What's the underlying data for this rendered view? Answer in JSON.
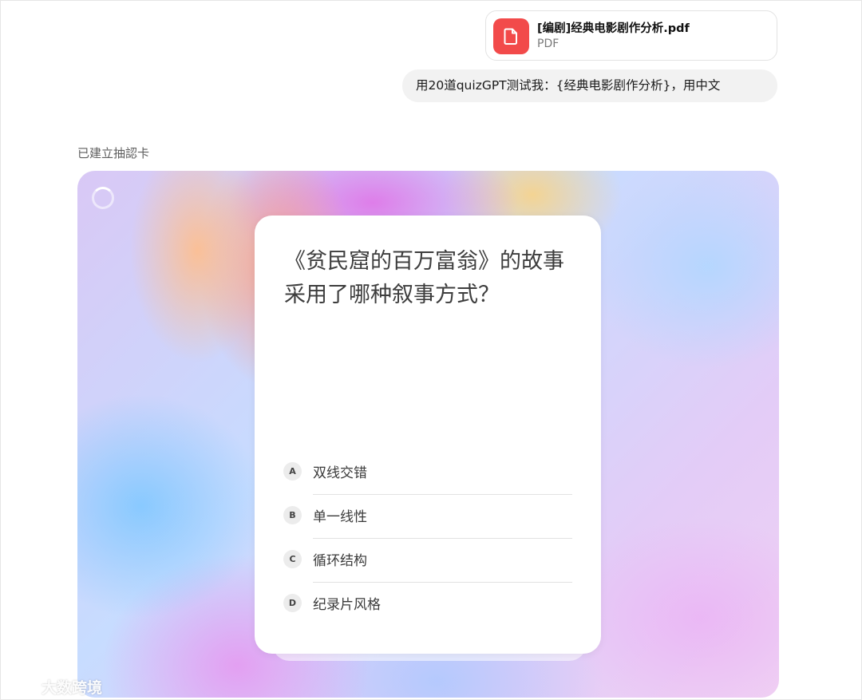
{
  "attachment": {
    "file_name": "[编剧]经典电影剧作分析.pdf",
    "file_type": "PDF",
    "icon": "document-icon",
    "icon_bg": "#f24a4a"
  },
  "user_message": "用20道quizGPT测试我：{经典电影剧作分析}，用中文",
  "status": "已建立抽認卡",
  "quiz": {
    "question": "《贫民窟的百万富翁》的故事采用了哪种叙事方式？",
    "options": [
      {
        "letter": "A",
        "text": "双线交错"
      },
      {
        "letter": "B",
        "text": "单一线性"
      },
      {
        "letter": "C",
        "text": "循环结构"
      },
      {
        "letter": "D",
        "text": "纪录片风格"
      }
    ]
  },
  "watermark": "大数跨境"
}
